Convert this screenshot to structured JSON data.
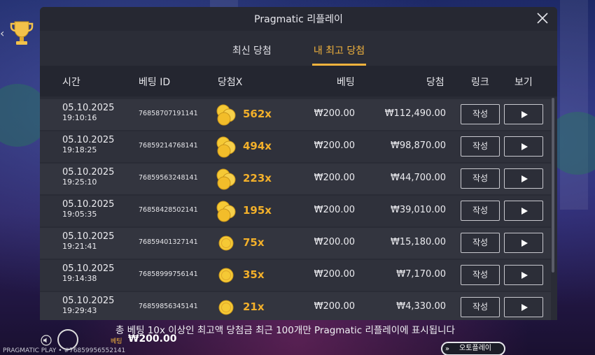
{
  "modal": {
    "title": "Pragmatic 리플레이",
    "tabs": [
      {
        "label": "최신 당첨",
        "active": false
      },
      {
        "label": "내 최고 당첨",
        "active": true
      }
    ],
    "columns": {
      "time": "시간",
      "bet_id": "베팅 ID",
      "multiplier": "당첨X",
      "bet": "베팅",
      "win": "당첨",
      "link": "링크",
      "view": "보기"
    },
    "rows": [
      {
        "date": "05.10.2025",
        "time": "19:10:16",
        "bet_id": "76858707191141",
        "multiplier": "562x",
        "coins": "stack",
        "bet": "₩200.00",
        "win": "₩112,490.00",
        "write_label": "작성"
      },
      {
        "date": "05.10.2025",
        "time": "19:18:25",
        "bet_id": "76859214768141",
        "multiplier": "494x",
        "coins": "stack",
        "bet": "₩200.00",
        "win": "₩98,870.00",
        "write_label": "작성"
      },
      {
        "date": "05.10.2025",
        "time": "19:25:10",
        "bet_id": "76859563248141",
        "multiplier": "223x",
        "coins": "stack",
        "bet": "₩200.00",
        "win": "₩44,700.00",
        "write_label": "작성"
      },
      {
        "date": "05.10.2025",
        "time": "19:05:35",
        "bet_id": "76858428502141",
        "multiplier": "195x",
        "coins": "stack",
        "bet": "₩200.00",
        "win": "₩39,010.00",
        "write_label": "작성"
      },
      {
        "date": "05.10.2025",
        "time": "19:21:41",
        "bet_id": "76859401327141",
        "multiplier": "75x",
        "coins": "single",
        "bet": "₩200.00",
        "win": "₩15,180.00",
        "write_label": "작성"
      },
      {
        "date": "05.10.2025",
        "time": "19:14:38",
        "bet_id": "76858999756141",
        "multiplier": "35x",
        "coins": "single",
        "bet": "₩200.00",
        "win": "₩7,170.00",
        "write_label": "작성"
      },
      {
        "date": "05.10.2025",
        "time": "19:29:43",
        "bet_id": "76859856345141",
        "multiplier": "21x",
        "coins": "single",
        "bet": "₩200.00",
        "win": "₩4,330.00",
        "write_label": "작성"
      }
    ]
  },
  "footer_note": "총 베팅 10x 이상인 최고액 당첨금 최근 100개만 Pragmatic 리플레이에 표시됩니다",
  "bottom_bar": {
    "brand": "PRAGMATIC PLAY • #76859956552141",
    "bet_label": "베팅",
    "bet_value": "₩200.00",
    "autoplay_label": "오토플레이"
  },
  "colors": {
    "accent": "#f2b33d",
    "multiplier": "#f3b02a",
    "modal_bg": "#2a2c36"
  }
}
